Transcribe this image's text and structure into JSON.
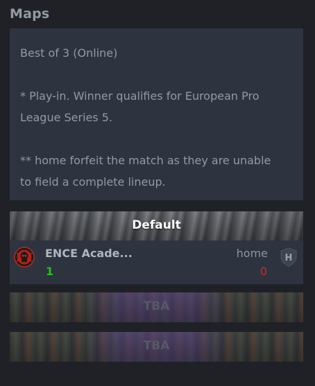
{
  "section": {
    "title": "Maps"
  },
  "info": {
    "line1": "Best of 3 (Online)",
    "line2": "* Play-in. Winner qualifies for European Pro",
    "line3": "League Series 5.",
    "line4": "** home forfeit the match as they are unable",
    "line5": "to field a complete lineup."
  },
  "maps": [
    {
      "name": "Default",
      "team1": {
        "name": "ENCE Acade...",
        "score": "1",
        "logo_icon": "ence-logo-icon",
        "score_color": "#27c21b"
      },
      "team2": {
        "name": "home",
        "score": "0",
        "logo_icon": "h-shield-icon",
        "logo_letter": "H",
        "score_color": "#e0211e"
      }
    },
    {
      "name": "TBA"
    },
    {
      "name": "TBA"
    }
  ],
  "colors": {
    "background": "#1f2126",
    "panel": "#2d3440",
    "text_muted": "#939aa4",
    "win": "#27c21b",
    "loss": "#e0211e"
  }
}
